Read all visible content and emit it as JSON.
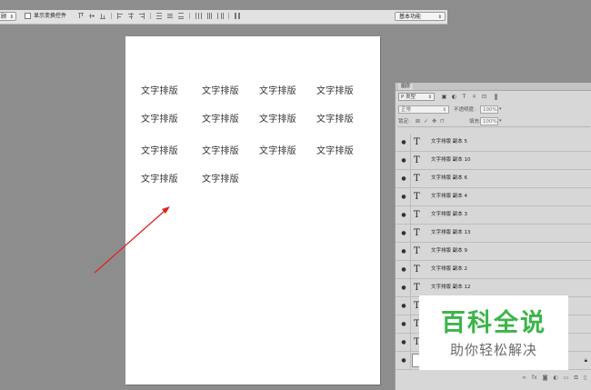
{
  "options_bar": {
    "left_select": "顾",
    "show_transform_label": "显示变换控件",
    "workspace": "基本功能"
  },
  "document": {
    "texts": [
      "文字排版",
      "文字排版",
      "文字排版",
      "文字排版",
      "文字排版",
      "文字排版",
      "文字排版",
      "文字排版",
      "文字排版",
      "文字排版",
      "文字排版",
      "文字排版",
      "文字排版",
      "文字排版"
    ]
  },
  "layers_panel": {
    "tab": "图层",
    "kind": "P 类型",
    "blend_mode": "正常",
    "opacity_label": "不透明度:",
    "opacity": "100%",
    "lock_label": "锁定:",
    "fill_label": "填充:",
    "fill": "100%",
    "layers": [
      {
        "name": "文字排版 副本 5"
      },
      {
        "name": "文字排版 副本 10"
      },
      {
        "name": "文字排版 副本 6"
      },
      {
        "name": "文字排版 副本 4"
      },
      {
        "name": "文字排版 副本 3"
      },
      {
        "name": "文字排版 副本 13"
      },
      {
        "name": "文字排版 副本 9"
      },
      {
        "name": "文字排版 副本 2"
      },
      {
        "name": "文字排版 副本 12"
      },
      {
        "name": ""
      },
      {
        "name": ""
      },
      {
        "name": ""
      }
    ]
  },
  "watermark": {
    "title": "百科全说",
    "subtitle": "助你轻松解决"
  },
  "colors": {
    "annotation_arrow": "#e02020",
    "watermark_green": "#3cb54a"
  }
}
